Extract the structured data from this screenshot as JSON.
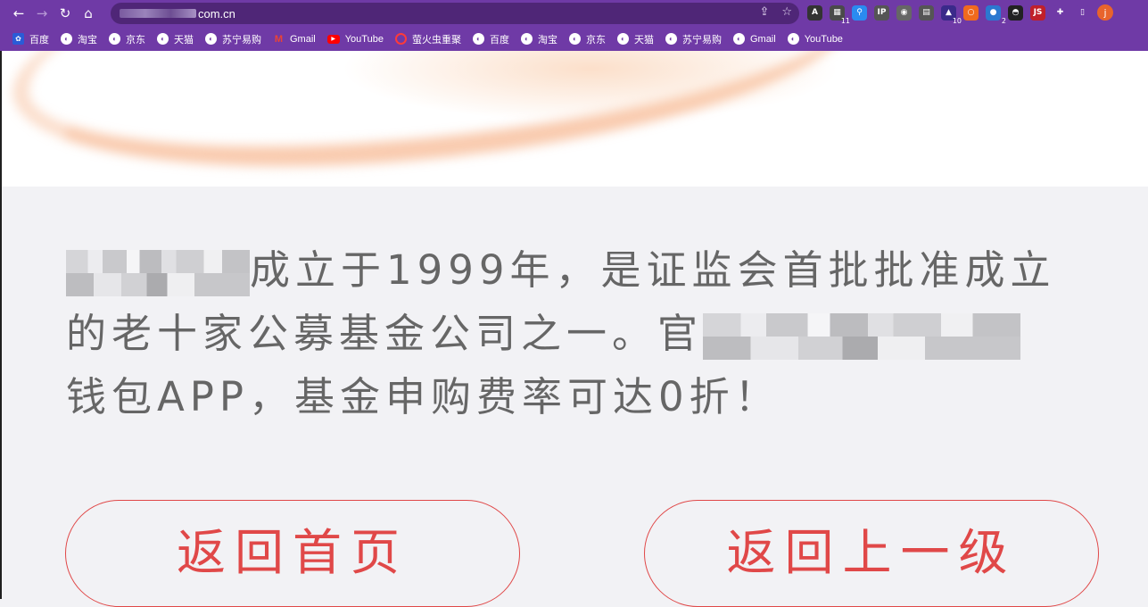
{
  "browser": {
    "url_visible": "com.cn",
    "nav": {
      "back": "←",
      "forward": "→",
      "reload": "↻",
      "home": "⌂"
    },
    "omnibox_icons": [
      "share-icon",
      "star-icon"
    ],
    "extensions": [
      {
        "name": "ext-a-icon",
        "glyph": "A",
        "color": "#333333"
      },
      {
        "name": "ext-qr-icon",
        "glyph": "▦",
        "color": "#4a4a4a",
        "badge": "11"
      },
      {
        "name": "ext-pin-icon",
        "glyph": "⚲",
        "color": "#2a8bf0"
      },
      {
        "name": "ext-ip-icon",
        "glyph": "IP",
        "color": "#555555"
      },
      {
        "name": "ext-circle-icon",
        "glyph": "◉",
        "color": "#666666"
      },
      {
        "name": "ext-reader-icon",
        "glyph": "▤",
        "color": "#555555"
      },
      {
        "name": "ext-hat-icon",
        "glyph": "▲",
        "color": "#3a2a8a",
        "badge": "10"
      },
      {
        "name": "ext-ring-icon",
        "glyph": "○",
        "color": "#f06a1e"
      },
      {
        "name": "ext-globe-icon",
        "glyph": "●",
        "color": "#2b78d0",
        "badge": "2"
      },
      {
        "name": "ext-spy-icon",
        "glyph": "◓",
        "color": "#222222"
      },
      {
        "name": "ext-js-icon",
        "glyph": "JS",
        "color": "#c0202a"
      },
      {
        "name": "extensions-puzzle-icon",
        "glyph": "✚",
        "color": "#6f3aa6"
      },
      {
        "name": "side-panel-icon",
        "glyph": "▯",
        "color": "#6f3aa6"
      }
    ],
    "profile_initial": "j",
    "bookmarks": [
      {
        "label": "百度",
        "icon": "baidu"
      },
      {
        "label": "淘宝",
        "icon": "globe"
      },
      {
        "label": "京东",
        "icon": "globe"
      },
      {
        "label": "天猫",
        "icon": "globe"
      },
      {
        "label": "苏宁易购",
        "icon": "globe"
      },
      {
        "label": "Gmail",
        "icon": "gmail"
      },
      {
        "label": "YouTube",
        "icon": "youtube"
      },
      {
        "label": "萤火虫重聚",
        "icon": "fire"
      },
      {
        "label": "百度",
        "icon": "globe"
      },
      {
        "label": "淘宝",
        "icon": "globe"
      },
      {
        "label": "京东",
        "icon": "globe"
      },
      {
        "label": "天猫",
        "icon": "globe"
      },
      {
        "label": "苏宁易购",
        "icon": "globe"
      },
      {
        "label": "Gmail",
        "icon": "globe"
      },
      {
        "label": "YouTube",
        "icon": "globe"
      }
    ]
  },
  "content": {
    "intro_part1": "成立于1999年，是证监会首批批准成立的老十家公募基金公司之一。官",
    "intro_part2": "钱包APP，基金申购费率可达0折！",
    "buttons": {
      "home": "返回首页",
      "back": "返回上一级"
    }
  }
}
